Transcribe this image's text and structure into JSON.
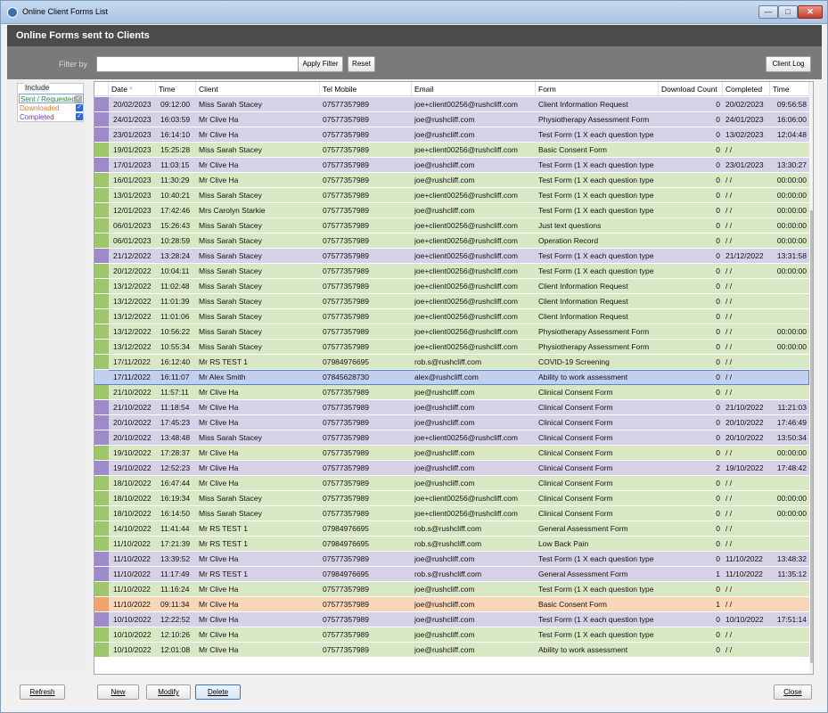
{
  "window": {
    "title": "Online Client Forms List",
    "min_glyph": "—",
    "max_glyph": "□",
    "close_glyph": "✕"
  },
  "header": {
    "title": "Online Forms sent to Clients"
  },
  "filter": {
    "label": "Filter by",
    "value": "",
    "apply_label": "Apply Filter",
    "reset_label": "Reset",
    "client_log_label": "Client Log"
  },
  "include": {
    "title": "Include",
    "items": [
      {
        "label": "Sent / Requested",
        "checked": true
      },
      {
        "label": "Downloaded",
        "checked": true
      },
      {
        "label": "Completed",
        "checked": true
      }
    ]
  },
  "grid": {
    "columns": [
      "Date",
      "Time",
      "Client",
      "Tel Mobile",
      "Email",
      "Form",
      "Download Count",
      "Completed",
      "Time"
    ],
    "sort_indicator": "^",
    "rows": [
      {
        "status": "completed",
        "date": "20/02/2023",
        "time": "09:12:00",
        "client": "Miss Sarah Stacey",
        "tel": "07577357989",
        "email": "joe+client00256@rushcliff.com",
        "form": "Client Information Request",
        "count": "0",
        "completed": "20/02/2023",
        "ctime": "09:56:58"
      },
      {
        "status": "completed",
        "date": "24/01/2023",
        "time": "16:03:59",
        "client": "Mr Clive Ha",
        "tel": "07577357989",
        "email": "joe@rushcliff.com",
        "form": "Physiotherapy Assessment Form",
        "count": "0",
        "completed": "24/01/2023",
        "ctime": "16:06:00"
      },
      {
        "status": "completed",
        "date": "23/01/2023",
        "time": "16:14:10",
        "client": "Mr Clive Ha",
        "tel": "07577357989",
        "email": "joe@rushcliff.com",
        "form": "Test Form (1 X each question type",
        "count": "0",
        "completed": "13/02/2023",
        "ctime": "12:04:48"
      },
      {
        "status": "sent",
        "date": "19/01/2023",
        "time": "15:25:28",
        "client": "Miss Sarah Stacey",
        "tel": "07577357989",
        "email": "joe+client00256@rushcliff.com",
        "form": "Basic Consent Form",
        "count": "0",
        "completed": "/ /",
        "ctime": ""
      },
      {
        "status": "completed",
        "date": "17/01/2023",
        "time": "11:03:15",
        "client": "Mr Clive Ha",
        "tel": "07577357989",
        "email": "joe@rushcliff.com",
        "form": "Test Form (1 X each question type",
        "count": "0",
        "completed": "23/01/2023",
        "ctime": "13:30:27"
      },
      {
        "status": "sent",
        "date": "16/01/2023",
        "time": "11:30:29",
        "client": "Mr Clive Ha",
        "tel": "07577357989",
        "email": "joe@rushcliff.com",
        "form": "Test Form (1 X each question type",
        "count": "0",
        "completed": "/ /",
        "ctime": "00:00:00"
      },
      {
        "status": "sent",
        "date": "13/01/2023",
        "time": "10:40:21",
        "client": "Miss Sarah Stacey",
        "tel": "07577357989",
        "email": "joe+client00256@rushcliff.com",
        "form": "Test Form (1 X each question type",
        "count": "0",
        "completed": "/ /",
        "ctime": "00:00:00"
      },
      {
        "status": "sent",
        "date": "12/01/2023",
        "time": "17:42:46",
        "client": "Mrs Carolyn Starkie",
        "tel": "07577357989",
        "email": "joe@rushcliff.com",
        "form": "Test Form (1 X each question type",
        "count": "0",
        "completed": "/ /",
        "ctime": "00:00:00"
      },
      {
        "status": "sent",
        "date": "06/01/2023",
        "time": "15:26:43",
        "client": "Miss Sarah Stacey",
        "tel": "07577357989",
        "email": "joe+client00256@rushcliff.com",
        "form": "Just text questions",
        "count": "0",
        "completed": "/ /",
        "ctime": "00:00:00"
      },
      {
        "status": "sent",
        "date": "06/01/2023",
        "time": "10:28:59",
        "client": "Miss Sarah Stacey",
        "tel": "07577357989",
        "email": "joe+client00256@rushcliff.com",
        "form": "Operation Record",
        "count": "0",
        "completed": "/ /",
        "ctime": "00:00:00"
      },
      {
        "status": "completed",
        "date": "21/12/2022",
        "time": "13:28:24",
        "client": "Miss Sarah Stacey",
        "tel": "07577357989",
        "email": "joe+client00256@rushcliff.com",
        "form": "Test Form (1 X each question type",
        "count": "0",
        "completed": "21/12/2022",
        "ctime": "13:31:58"
      },
      {
        "status": "sent",
        "date": "20/12/2022",
        "time": "10:04:11",
        "client": "Miss Sarah Stacey",
        "tel": "07577357989",
        "email": "joe+client00256@rushcliff.com",
        "form": "Test Form (1 X each question type",
        "count": "0",
        "completed": "/ /",
        "ctime": "00:00:00"
      },
      {
        "status": "sent",
        "date": "13/12/2022",
        "time": "11:02:48",
        "client": "Miss Sarah Stacey",
        "tel": "07577357989",
        "email": "joe+client00256@rushcliff.com",
        "form": "Client Information Request",
        "count": "0",
        "completed": "/ /",
        "ctime": ""
      },
      {
        "status": "sent",
        "date": "13/12/2022",
        "time": "11:01:39",
        "client": "Miss Sarah Stacey",
        "tel": "07577357989",
        "email": "joe+client00256@rushcliff.com",
        "form": "Client Information Request",
        "count": "0",
        "completed": "/ /",
        "ctime": ""
      },
      {
        "status": "sent",
        "date": "13/12/2022",
        "time": "11:01:06",
        "client": "Miss Sarah Stacey",
        "tel": "07577357989",
        "email": "joe+client00256@rushcliff.com",
        "form": "Client Information Request",
        "count": "0",
        "completed": "/ /",
        "ctime": ""
      },
      {
        "status": "sent",
        "date": "13/12/2022",
        "time": "10:56:22",
        "client": "Miss Sarah Stacey",
        "tel": "07577357989",
        "email": "joe+client00256@rushcliff.com",
        "form": "Physiotherapy Assessment Form",
        "count": "0",
        "completed": "/ /",
        "ctime": "00:00:00"
      },
      {
        "status": "sent",
        "date": "13/12/2022",
        "time": "10:55:34",
        "client": "Miss Sarah Stacey",
        "tel": "07577357989",
        "email": "joe+client00256@rushcliff.com",
        "form": "Physiotherapy Assessment Form",
        "count": "0",
        "completed": "/ /",
        "ctime": "00:00:00"
      },
      {
        "status": "sent",
        "date": "17/11/2022",
        "time": "16:12:40",
        "client": "Mr RS TEST 1",
        "tel": "07984976695",
        "email": "rob.s@rushcliff.com",
        "form": "COVID-19 Screening",
        "count": "0",
        "completed": "/ /",
        "ctime": ""
      },
      {
        "status": "sent",
        "selected": true,
        "date": "17/11/2022",
        "time": "16:11:07",
        "client": "Mr Alex Smith",
        "tel": "07845628730",
        "email": "alex@rushcliff.com",
        "form": "Ability to work assessment",
        "count": "0",
        "completed": "/ /",
        "ctime": ""
      },
      {
        "status": "sent",
        "date": "21/10/2022",
        "time": "11:57:11",
        "client": "Mr Clive Ha",
        "tel": "07577357989",
        "email": "joe@rushcliff.com",
        "form": "Clinical Consent Form",
        "count": "0",
        "completed": "/ /",
        "ctime": ""
      },
      {
        "status": "completed",
        "date": "21/10/2022",
        "time": "11:18:54",
        "client": "Mr Clive Ha",
        "tel": "07577357989",
        "email": "joe@rushcliff.com",
        "form": "Clinical Consent Form",
        "count": "0",
        "completed": "21/10/2022",
        "ctime": "11:21:03"
      },
      {
        "status": "completed",
        "date": "20/10/2022",
        "time": "17:45:23",
        "client": "Mr Clive Ha",
        "tel": "07577357989",
        "email": "joe@rushcliff.com",
        "form": "Clinical Consent Form",
        "count": "0",
        "completed": "20/10/2022",
        "ctime": "17:46:49"
      },
      {
        "status": "completed",
        "date": "20/10/2022",
        "time": "13:48:48",
        "client": "Miss Sarah Stacey",
        "tel": "07577357989",
        "email": "joe+client00256@rushcliff.com",
        "form": "Clinical Consent Form",
        "count": "0",
        "completed": "20/10/2022",
        "ctime": "13:50:34"
      },
      {
        "status": "sent",
        "date": "19/10/2022",
        "time": "17:28:37",
        "client": "Mr Clive Ha",
        "tel": "07577357989",
        "email": "joe@rushcliff.com",
        "form": "Clinical Consent Form",
        "count": "0",
        "completed": "/ /",
        "ctime": "00:00:00"
      },
      {
        "status": "completed",
        "date": "19/10/2022",
        "time": "12:52:23",
        "client": "Mr Clive Ha",
        "tel": "07577357989",
        "email": "joe@rushcliff.com",
        "form": "Clinical Consent Form",
        "count": "2",
        "completed": "19/10/2022",
        "ctime": "17:48:42"
      },
      {
        "status": "sent",
        "date": "18/10/2022",
        "time": "16:47:44",
        "client": "Mr Clive Ha",
        "tel": "07577357989",
        "email": "joe@rushcliff.com",
        "form": "Clinical Consent Form",
        "count": "0",
        "completed": "/ /",
        "ctime": ""
      },
      {
        "status": "sent",
        "date": "18/10/2022",
        "time": "16:19:34",
        "client": "Miss Sarah Stacey",
        "tel": "07577357989",
        "email": "joe+client00256@rushcliff.com",
        "form": "Clinical Consent Form",
        "count": "0",
        "completed": "/ /",
        "ctime": "00:00:00"
      },
      {
        "status": "sent",
        "date": "18/10/2022",
        "time": "16:14:50",
        "client": "Miss Sarah Stacey",
        "tel": "07577357989",
        "email": "joe+client00256@rushcliff.com",
        "form": "Clinical Consent Form",
        "count": "0",
        "completed": "/ /",
        "ctime": "00:00:00"
      },
      {
        "status": "sent",
        "date": "14/10/2022",
        "time": "11:41:44",
        "client": "Mr RS TEST 1",
        "tel": "07984976695",
        "email": "rob.s@rushcliff.com",
        "form": "General Assessment Form",
        "count": "0",
        "completed": "/ /",
        "ctime": ""
      },
      {
        "status": "sent",
        "date": "11/10/2022",
        "time": "17:21:39",
        "client": "Mr RS TEST 1",
        "tel": "07984976695",
        "email": "rob.s@rushcliff.com",
        "form": "Low Back Pain",
        "count": "0",
        "completed": "/ /",
        "ctime": ""
      },
      {
        "status": "completed",
        "date": "11/10/2022",
        "time": "13:39:52",
        "client": "Mr Clive Ha",
        "tel": "07577357989",
        "email": "joe@rushcliff.com",
        "form": "Test Form (1 X each question type",
        "count": "0",
        "completed": "11/10/2022",
        "ctime": "13:48:32"
      },
      {
        "status": "completed",
        "date": "11/10/2022",
        "time": "11:17:49",
        "client": "Mr RS TEST 1",
        "tel": "07984976695",
        "email": "rob.s@rushcliff.com",
        "form": "General Assessment Form",
        "count": "1",
        "completed": "11/10/2022",
        "ctime": "11:35:12"
      },
      {
        "status": "sent",
        "date": "11/10/2022",
        "time": "11:16:24",
        "client": "Mr Clive Ha",
        "tel": "07577357989",
        "email": "joe@rushcliff.com",
        "form": "Test Form (1 X each question type",
        "count": "0",
        "completed": "/ /",
        "ctime": ""
      },
      {
        "status": "downloaded",
        "date": "11/10/2022",
        "time": "09:11:34",
        "client": "Mr Clive Ha",
        "tel": "07577357989",
        "email": "joe@rushcliff.com",
        "form": "Basic Consent Form",
        "count": "1",
        "completed": "/ /",
        "ctime": ""
      },
      {
        "status": "completed",
        "date": "10/10/2022",
        "time": "12:22:52",
        "client": "Mr Clive Ha",
        "tel": "07577357989",
        "email": "joe@rushcliff.com",
        "form": "Test Form (1 X each question type",
        "count": "0",
        "completed": "10/10/2022",
        "ctime": "17:51:14"
      },
      {
        "status": "sent",
        "date": "10/10/2022",
        "time": "12:10:26",
        "client": "Mr Clive Ha",
        "tel": "07577357989",
        "email": "joe@rushcliff.com",
        "form": "Test Form (1 X each question type",
        "count": "0",
        "completed": "/ /",
        "ctime": ""
      },
      {
        "status": "sent",
        "date": "10/10/2022",
        "time": "12:01:08",
        "client": "Mr Clive Ha",
        "tel": "07577357989",
        "email": "joe@rushcliff.com",
        "form": "Ability to work assessment",
        "count": "0",
        "completed": "/ /",
        "ctime": ""
      }
    ]
  },
  "footer": {
    "refresh_label": "Refresh",
    "new_label": "New",
    "modify_label": "Modify",
    "delete_label": "Delete",
    "close_label": "Close"
  },
  "colors": {
    "sent": "#d9e8c4",
    "completed": "#d5d1e6",
    "downloaded": "#f8d6b8",
    "selected": "#c0d0ee"
  }
}
